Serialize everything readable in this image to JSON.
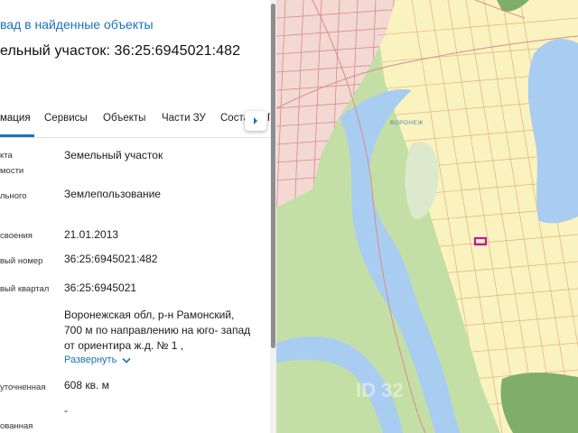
{
  "panel": {
    "back_link": "вад в найденные объекты",
    "title": "ельный участок: 36:25:6945021:482",
    "tabs": [
      {
        "label": "мация",
        "active": true
      },
      {
        "label": "Сервисы",
        "active": false
      },
      {
        "label": "Объекты",
        "active": false
      },
      {
        "label": "Части ЗУ",
        "active": false
      },
      {
        "label": "Соста",
        "active": false
      },
      {
        "label": "Г",
        "active": false
      }
    ],
    "fields": [
      {
        "label_lines": [
          "кта",
          "мости"
        ],
        "value": "Земельный участок"
      },
      {
        "label_lines": [
          "льного"
        ],
        "value": "Землепользование"
      },
      {
        "label_lines": [
          "своения"
        ],
        "value": "21.01.2013"
      },
      {
        "label_lines": [
          "вый номер"
        ],
        "value": "36:25:6945021:482"
      },
      {
        "label_lines": [
          "вый квартал"
        ],
        "value": "36:25:6945021"
      },
      {
        "label_lines": [],
        "value_lines": [
          "Воронежская обл, р-н Рамонский,",
          "700 м по направлению на юго- запад",
          "от ориентира ж.д. № 1 ,"
        ]
      },
      {
        "label_lines": [
          "уточненная"
        ],
        "value": "608 кв. м"
      },
      {
        "label_lines": [
          "ованная"
        ],
        "value": "-"
      }
    ],
    "expand_label": "Развернуть"
  },
  "map": {
    "river_label": "ВОРОНЕЖ",
    "watermark": "ID 32",
    "colors": {
      "water": "#a9cdf0",
      "forest": "#c4dfa6",
      "dark_forest": "#7fae6a",
      "field": "#fbf3bf",
      "urban": "#f3d8d4",
      "parcel_lines": "#d98a8a",
      "selected_parcel": "#c0189a"
    }
  },
  "icons": {
    "tab_next": "chevron-right-icon",
    "expand": "chevron-down-icon"
  }
}
